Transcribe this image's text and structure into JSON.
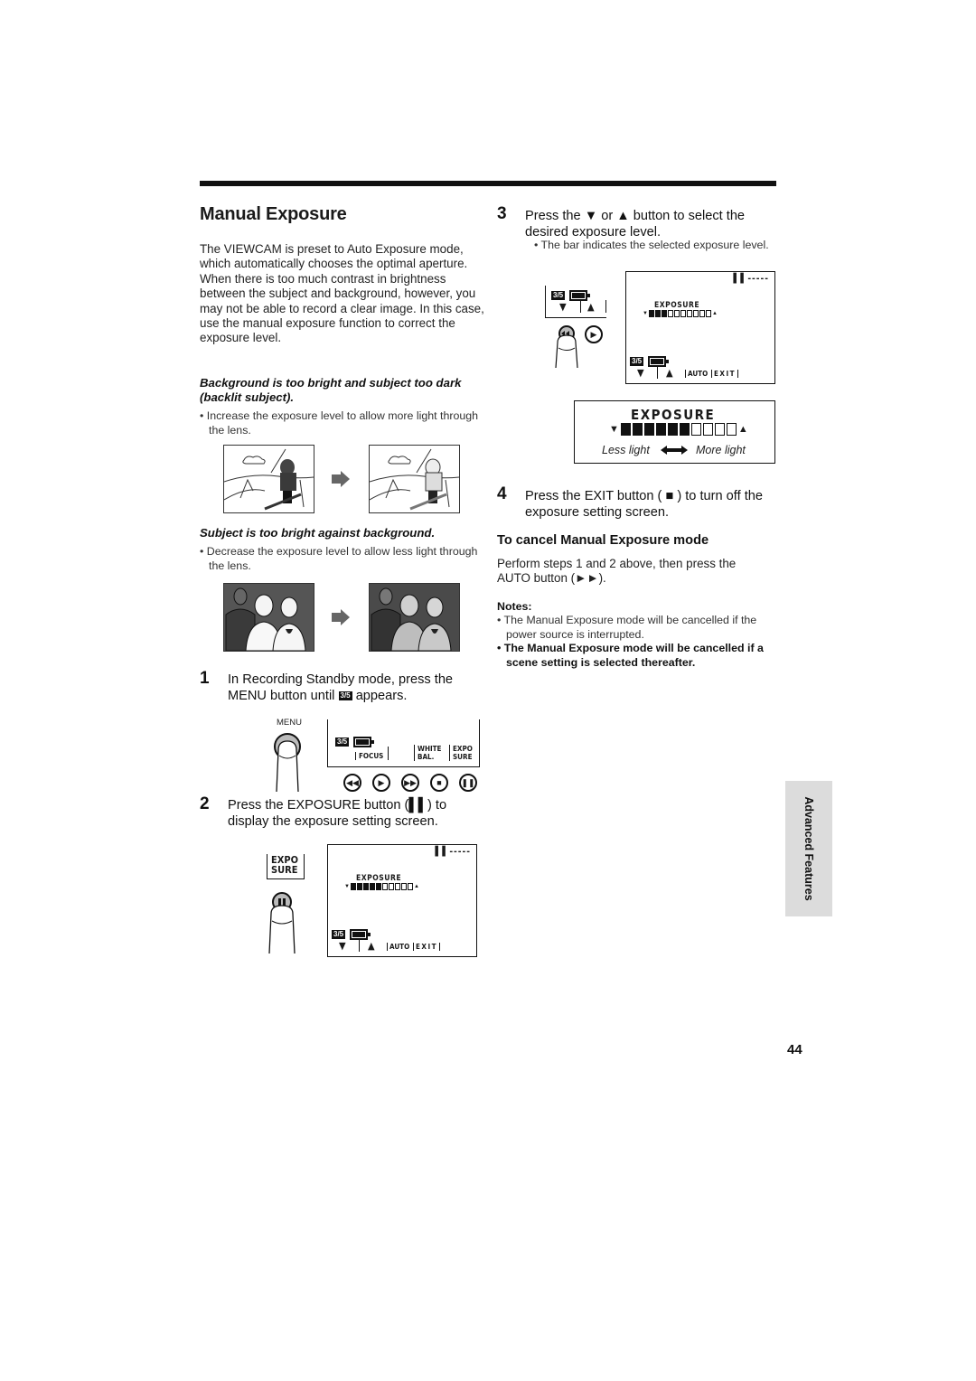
{
  "page": {
    "title": "Manual Exposure",
    "intro": "The VIEWCAM is preset to Auto Exposure mode, which automatically chooses the optimal aperture. When there is too much contrast in brightness between the subject and background, however, you may not be able to record a clear image. In this case, use the manual exposure function to correct the exposure level.",
    "page_number": "44",
    "side_tab": "Advanced Features"
  },
  "cases": [
    {
      "heading": "Background is too bright and subject too dark  (backlit subject).",
      "bullet": "• Increase the exposure level to allow more light through the lens.",
      "images": [
        "backlit-skier-before",
        "backlit-skier-after"
      ]
    },
    {
      "heading": "Subject is too bright against background.",
      "bullet": "• Decrease the exposure level to allow less light through the lens.",
      "images": [
        "bright-group-before",
        "bright-group-after"
      ]
    }
  ],
  "steps": [
    {
      "num": "1",
      "text_a": "In Recording Standby mode, press the MENU button until",
      "text_b": "appears."
    },
    {
      "num": "2",
      "text": "Press the EXPOSURE button (▌▌) to display the exposure setting screen."
    },
    {
      "num": "3",
      "text": "Press the ▼ or ▲ button to select the desired exposure level.",
      "bullet": "• The bar indicates the selected exposure level."
    },
    {
      "num": "4",
      "text": "Press the EXIT button ( ■ ) to turn off the exposure setting screen."
    }
  ],
  "menu_screen": {
    "menu_label": "MENU",
    "page_badge": "3/5",
    "items": [
      "FOCUS",
      "WHITE BAL.",
      "EXPO SURE"
    ],
    "white_1": "WHITE",
    "white_2": "BAL.",
    "expo_1": "EXPO",
    "expo_2": "SURE",
    "buttons": [
      "rewind",
      "play",
      "fast-forward",
      "stop",
      "pause"
    ]
  },
  "exposure_screen": {
    "status": "▌▌-----",
    "label": "EXPOSURE",
    "page_badge": "3/5",
    "down": "▼",
    "up": "▲",
    "auto": "AUTO",
    "exit": "EXIT",
    "expo_button_1": "EXPO",
    "expo_button_2": "SURE",
    "step2_level": 0.5,
    "step3_level": 0.3,
    "segments_total": 10
  },
  "level_diagram": {
    "label": "EXPOSURE",
    "level": 0.6,
    "less": "Less light",
    "more": "More light"
  },
  "cancel": {
    "heading": "To cancel Manual Exposure mode",
    "text": "Perform steps 1 and 2 above, then press the AUTO button (►►)."
  },
  "notes": {
    "heading": "Notes:",
    "items": [
      "• The Manual Exposure mode will be cancelled if the power source is interrupted.",
      "• The Manual Exposure mode will be cancelled if a scene setting is selected thereafter."
    ]
  }
}
